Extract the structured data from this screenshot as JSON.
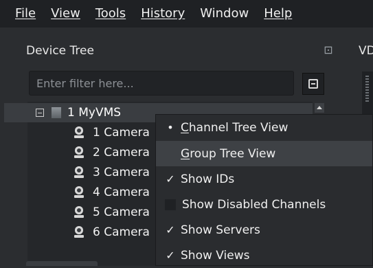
{
  "menubar": {
    "items": [
      {
        "label": "File"
      },
      {
        "label": "View"
      },
      {
        "label": "Tools"
      },
      {
        "label": "History"
      },
      {
        "label": "Window"
      },
      {
        "label": "Help"
      }
    ]
  },
  "panel": {
    "title": "Device Tree",
    "title_icon": "panel-menu-icon",
    "next_panel_label": "VD"
  },
  "filter": {
    "placeholder": "Enter filter here...",
    "value": ""
  },
  "tree": {
    "root": {
      "label": "1 MyVMS",
      "icon": "server-icon",
      "expanded": true
    },
    "cameras": [
      {
        "label": "1 Camera"
      },
      {
        "label": "2 Camera"
      },
      {
        "label": "3 Camera"
      },
      {
        "label": "4 Camera"
      },
      {
        "label": "5 Camera"
      },
      {
        "label": "6 Camera"
      }
    ]
  },
  "context_menu": {
    "items": [
      {
        "label": "Channel Tree View",
        "mark": "•",
        "type": "radio",
        "checked": true
      },
      {
        "label": "Group Tree View",
        "mark": "",
        "type": "radio",
        "checked": false,
        "highlighted": true
      },
      {
        "label": "Show IDs",
        "mark": "✓",
        "type": "check",
        "checked": true
      },
      {
        "label": "Show Disabled Channels",
        "mark": "",
        "type": "check",
        "checked": false
      },
      {
        "label": "Show Servers",
        "mark": "✓",
        "type": "check",
        "checked": true
      },
      {
        "label": "Show Views",
        "mark": "✓",
        "type": "check",
        "checked": true
      }
    ]
  },
  "colors": {
    "background": "#2b2d30",
    "menubar": "#1f2124",
    "menu_highlight": "#3e4145",
    "text": "#f0f0f0"
  }
}
